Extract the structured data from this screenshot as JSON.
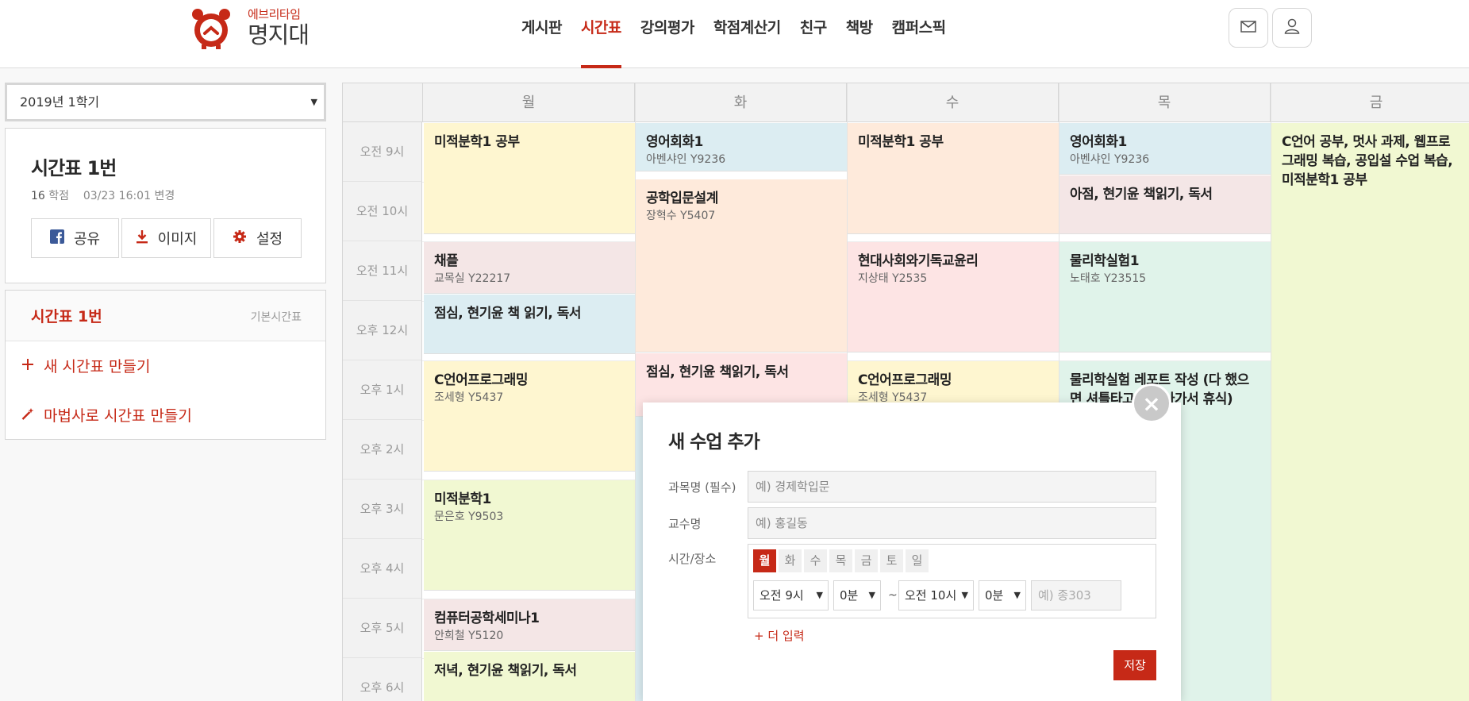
{
  "header": {
    "logo_sub": "에브리타임",
    "logo_main": "명지대",
    "nav": [
      "게시판",
      "시간표",
      "강의평가",
      "학점계산기",
      "친구",
      "책방",
      "캠퍼스픽"
    ],
    "active_nav": "시간표",
    "message_icon": "envelope-icon",
    "profile_icon": "user-icon"
  },
  "sidebar": {
    "semester": "2019년 1학기",
    "timetable_title": "시간표 1번",
    "credits": "16",
    "credits_unit": "학점",
    "updated": "03/23 16:01 변경",
    "buttons": {
      "share": "공유",
      "image": "이미지",
      "settings": "설정"
    },
    "list_name": "시간표 1번",
    "list_tag": "기본시간표",
    "new_timetable": "새 시간표 만들기",
    "wizard": "마법사로 시간표 만들기"
  },
  "grid": {
    "days": [
      "월",
      "화",
      "수",
      "목",
      "금"
    ],
    "times": [
      "오전 9시",
      "오전 10시",
      "오전 11시",
      "오후 12시",
      "오후 1시",
      "오후 2시",
      "오후 3시",
      "오후 4시",
      "오후 5시",
      "오후 6시"
    ],
    "blocks": [
      {
        "title": "미적분학1 공부",
        "sub": ""
      },
      {
        "title": "채플",
        "sub": "교목실 Y22217"
      },
      {
        "title": "점심, 현기윤 책 읽기, 독서",
        "sub": ""
      },
      {
        "title": "C언어프로그래밍",
        "sub": "조세형 Y5437"
      },
      {
        "title": "미적분학1",
        "sub": "문은호 Y9503"
      },
      {
        "title": "컴퓨터공학세미나1",
        "sub": "안희철 Y5120"
      },
      {
        "title": "저녁, 현기윤 책읽기, 독서",
        "sub": ""
      },
      {
        "title": "영어회화1",
        "sub": "아벤샤인 Y9236"
      },
      {
        "title": "공학입문설계",
        "sub": "장혁수 Y5407"
      },
      {
        "title": "점심, 현기윤 책읽기, 독서",
        "sub": ""
      },
      {
        "title": "미적분학1 공부",
        "sub": ""
      },
      {
        "title": "현대사회와기독교윤리",
        "sub": "지상태 Y2535"
      },
      {
        "title": "C언어프로그래밍",
        "sub": "조세형 Y5437"
      },
      {
        "title": "영어회화1",
        "sub": "아벤샤인 Y9236"
      },
      {
        "title": "아점, 현기윤 책읽기, 독서",
        "sub": ""
      },
      {
        "title": "물리학실험1",
        "sub": "노태호 Y23515"
      },
      {
        "title": "물리학실험 레포트 작성 (다 했으면 셔틀타고 기숙사가서 휴식)",
        "sub": ""
      },
      {
        "title": "C언어 공부, 멋사 과제, 웹프로그래밍 복습, 공입설 수업 복습, 미적분학1 공부",
        "sub": ""
      }
    ],
    "colors": {
      "yellow": "#fef6d0",
      "blue": "#dcedf2",
      "peach": "#feeadb",
      "pink": "#f4e6e6",
      "rose": "#fde4e4",
      "mint": "#e0f3ea",
      "lime": "#f1f8d2"
    }
  },
  "modal": {
    "title": "새 수업 추가",
    "course_label": "과목명 (필수)",
    "course_placeholder": "예) 경제학입문",
    "prof_label": "교수명",
    "prof_placeholder": "예) 홍길동",
    "time_label": "시간/장소",
    "days": [
      "월",
      "화",
      "수",
      "목",
      "금",
      "토",
      "일"
    ],
    "selected_day": "월",
    "start_hour": "오전 9시",
    "start_min": "0분",
    "tilde": "~",
    "end_hour": "오전 10시",
    "end_min": "0분",
    "place_placeholder": "예) 종303",
    "more": "더 입력",
    "save": "저장",
    "close": "×"
  }
}
